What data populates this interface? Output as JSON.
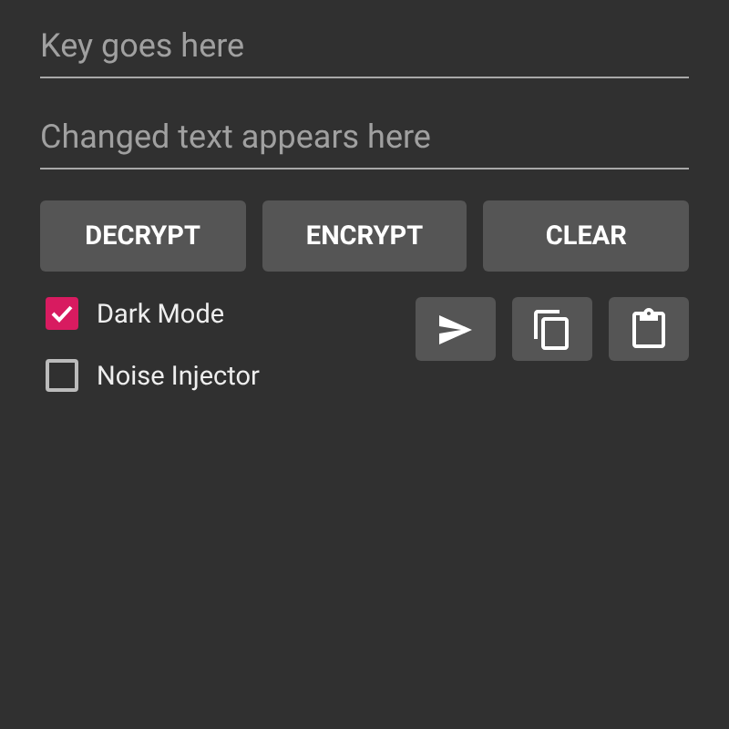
{
  "fields": [
    {
      "placeholder": "Key goes here"
    },
    {
      "placeholder": "Changed text appears here"
    }
  ],
  "buttons": [
    "DECRYPT",
    "ENCRYPT",
    "CLEAR"
  ],
  "options": [
    {
      "label": "Dark Mode",
      "checked": true
    },
    {
      "label": "Noise Injector",
      "checked": false
    }
  ],
  "icon_buttons": [
    {
      "kind": "send"
    },
    {
      "kind": "copy"
    },
    {
      "kind": "paste"
    }
  ]
}
